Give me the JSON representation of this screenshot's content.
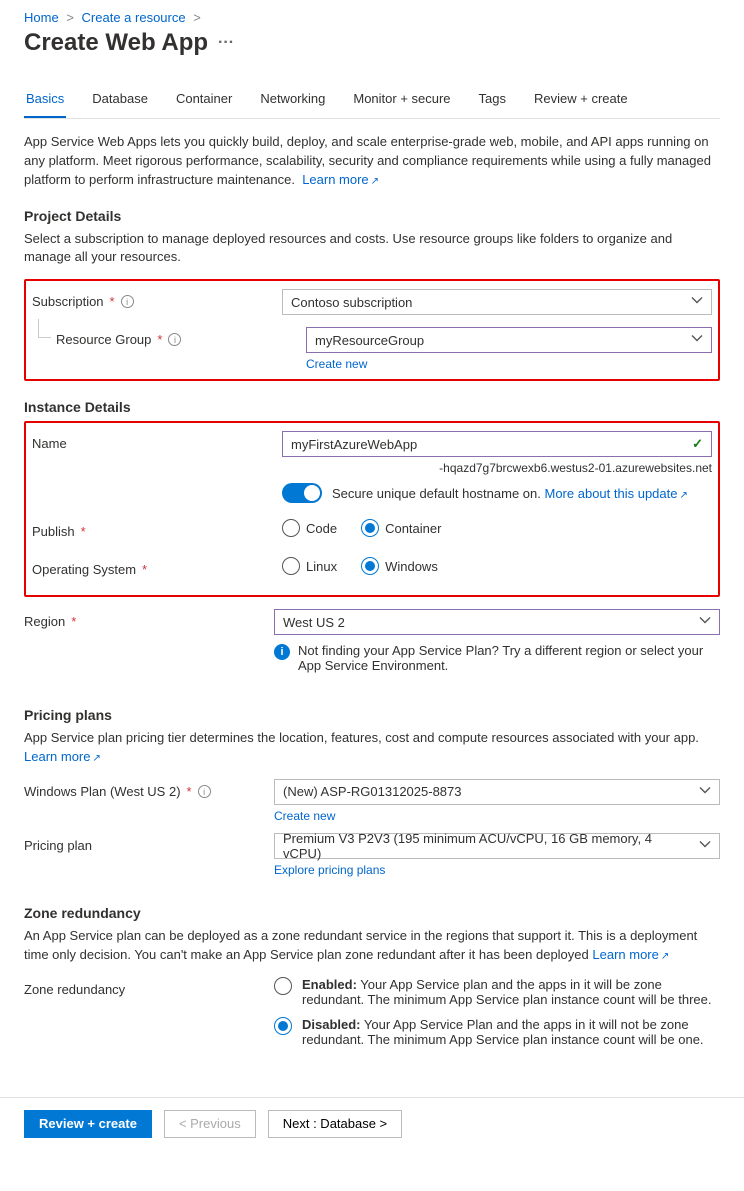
{
  "breadcrumb": {
    "home": "Home",
    "create_resource": "Create a resource"
  },
  "page_title": "Create Web App",
  "tabs": [
    "Basics",
    "Database",
    "Container",
    "Networking",
    "Monitor + secure",
    "Tags",
    "Review + create"
  ],
  "intro": {
    "text": "App Service Web Apps lets you quickly build, deploy, and scale enterprise-grade web, mobile, and API apps running on any platform. Meet rigorous performance, scalability, security and compliance requirements while using a fully managed platform to perform infrastructure maintenance.",
    "learn_more": "Learn more"
  },
  "project": {
    "heading": "Project Details",
    "sub": "Select a subscription to manage deployed resources and costs. Use resource groups like folders to organize and manage all your resources.",
    "subscription_label": "Subscription",
    "subscription_value": "Contoso subscription",
    "rg_label": "Resource Group",
    "rg_value": "myResourceGroup",
    "create_new": "Create new"
  },
  "instance": {
    "heading": "Instance Details",
    "name_label": "Name",
    "name_value": "myFirstAzureWebApp",
    "domain_suffix": "-hqazd7g7brcwexb6.westus2-01.azurewebsites.net",
    "toggle_text": "Secure unique default hostname on.",
    "toggle_link": "More about this update",
    "publish_label": "Publish",
    "publish_options": [
      "Code",
      "Container"
    ],
    "publish_selected": 1,
    "os_label": "Operating System",
    "os_options": [
      "Linux",
      "Windows"
    ],
    "os_selected": 1
  },
  "region": {
    "label": "Region",
    "value": "West US 2",
    "info": "Not finding your App Service Plan? Try a different region or select your App Service Environment."
  },
  "pricing": {
    "heading": "Pricing plans",
    "sub": "App Service plan pricing tier determines the location, features, cost and compute resources associated with your app.",
    "learn_more": "Learn more",
    "plan_label": "Windows Plan (West US 2)",
    "plan_value": "(New) ASP-RG01312025-8873",
    "create_new": "Create new",
    "tier_label": "Pricing plan",
    "tier_value": "Premium V3 P2V3 (195 minimum ACU/vCPU, 16 GB memory, 4 vCPU)",
    "explore": "Explore pricing plans"
  },
  "zone": {
    "heading": "Zone redundancy",
    "sub": "An App Service plan can be deployed as a zone redundant service in the regions that support it. This is a deployment time only decision. You can't make an App Service plan zone redundant after it has been deployed",
    "learn_more": "Learn more",
    "label": "Zone redundancy",
    "enabled_title": "Enabled:",
    "enabled_text": " Your App Service plan and the apps in it will be zone redundant. The minimum App Service plan instance count will be three.",
    "disabled_title": "Disabled:",
    "disabled_text": " Your App Service Plan and the apps in it will not be zone redundant. The minimum App Service plan instance count will be one."
  },
  "footer": {
    "review": "Review + create",
    "prev": "< Previous",
    "next": "Next : Database >"
  }
}
